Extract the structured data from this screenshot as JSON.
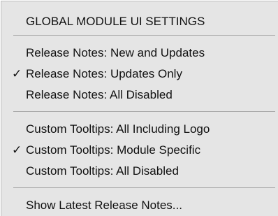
{
  "menu": {
    "header": "GLOBAL MODULE UI SETTINGS",
    "release_notes": [
      {
        "label": "Release Notes: New and Updates",
        "checked": false
      },
      {
        "label": "Release Notes: Updates Only",
        "checked": true
      },
      {
        "label": "Release Notes: All Disabled",
        "checked": false
      }
    ],
    "tooltips": [
      {
        "label": "Custom Tooltips: All Including Logo",
        "checked": false
      },
      {
        "label": "Custom Tooltips: Module Specific",
        "checked": true
      },
      {
        "label": "Custom Tooltips: All Disabled",
        "checked": false
      }
    ],
    "show_latest": "Show Latest Release Notes...",
    "check_glyph": "✓"
  }
}
